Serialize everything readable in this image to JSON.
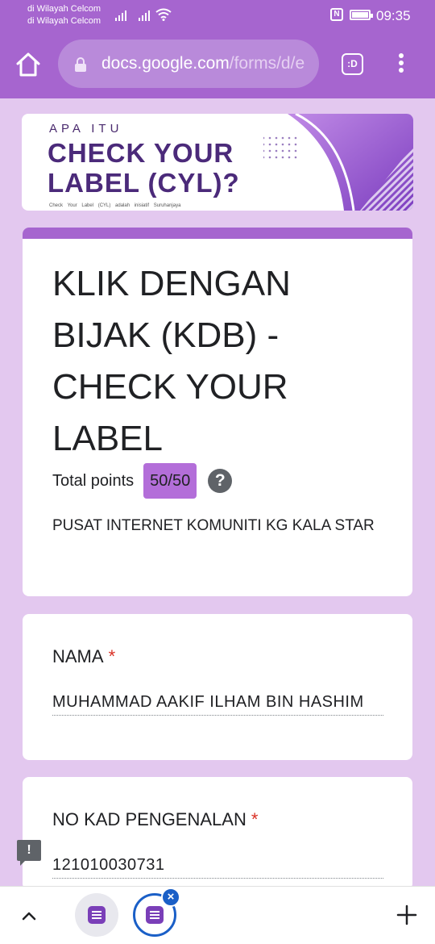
{
  "status_bar": {
    "carrier_line1": "di Wilayah Celcom",
    "carrier_line2": "di Wilayah Celcom",
    "time": "09:35",
    "nfc": "N"
  },
  "browser": {
    "url_host": "docs.google.com",
    "url_path": "/forms/d/e",
    "tabs_label": ":D",
    "accent_color": "#a665cf"
  },
  "banner": {
    "small_text": "APA ITU",
    "line1": "CHECK YOUR",
    "line2": "LABEL (CYL)?",
    "tiny_text": "Check Your Label (CYL) adalah inisiatif Suruhanjaya"
  },
  "form": {
    "title": "KLIK DENGAN BIJAK (KDB) - CHECK YOUR LABEL",
    "points_label": "Total points",
    "points_value": "50/50",
    "help_icon": "?",
    "description": "PUSAT INTERNET KOMUNITI KG KALA STAR"
  },
  "questions": [
    {
      "label": "NAMA",
      "required": "*",
      "answer": "MUHAMMAD AAKIF ILHAM BIN HASHIM"
    },
    {
      "label": "NO KAD PENGENALAN",
      "required": "*",
      "answer": "121010030731"
    }
  ],
  "report_icon": "!",
  "bottom_bar": {
    "close_glyph": "×",
    "icons": [
      "chevron-up-icon",
      "forms-favicon",
      "forms-favicon",
      "close-icon",
      "plus-icon"
    ]
  }
}
